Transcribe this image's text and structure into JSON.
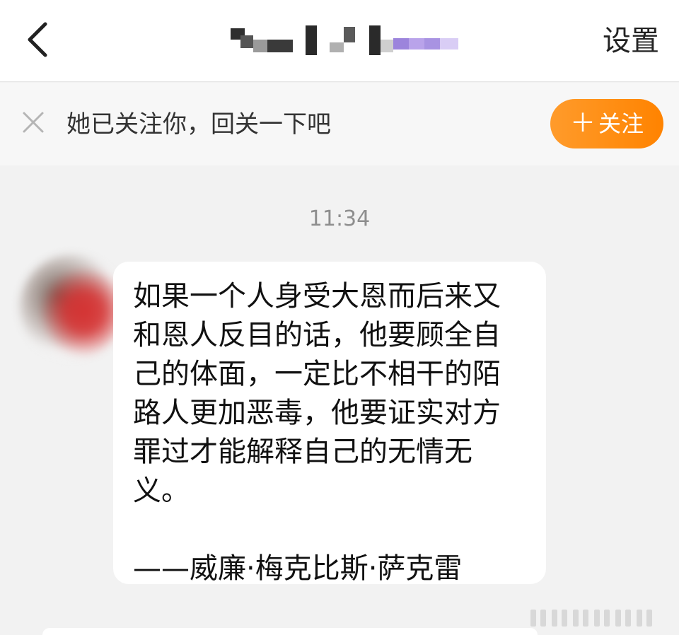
{
  "navbar": {
    "back_icon": "chevron-left-icon",
    "settings_label": "设置",
    "title_redaction_colors": [
      "#3a3a3a",
      "#6a6a6a",
      "#a98fe0",
      "#c7b6f0"
    ]
  },
  "follow_bar": {
    "dismiss_icon": "close-icon",
    "message": "她已关注你，回关一下吧",
    "button_label": "关注",
    "button_icon": "plus-icon",
    "button_color": "#ff8c1a"
  },
  "chat": {
    "timestamp": "11:34",
    "messages": [
      {
        "sender": "other",
        "lines": [
          "如果一个人身受大恩而后来又",
          "和恩人反目的话，他要顾全自",
          "己的体面，一定比不相干的陌",
          "路人更加恶毒，他要证实对方",
          "罪过才能解释自己的无情无",
          "义。"
        ],
        "attribution": "——威廉·梅克比斯·萨克雷"
      }
    ]
  }
}
